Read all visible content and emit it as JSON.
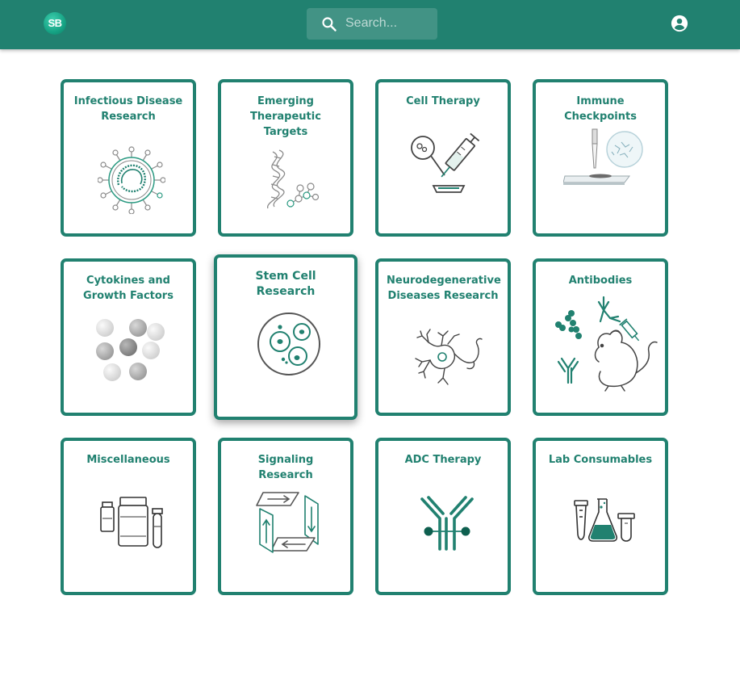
{
  "header": {
    "logo_text": "SB",
    "search_placeholder": "Search...",
    "brand_color": "#218170"
  },
  "icons": {
    "logo": "sb-logo-icon",
    "search": "search-icon",
    "account": "account-circle-icon"
  },
  "categories": [
    {
      "title": "Infectious Disease Research",
      "icon": "virus-icon"
    },
    {
      "title": "Emerging Therapeutic Targets",
      "icon": "dna-molecule-icon"
    },
    {
      "title": "Cell Therapy",
      "icon": "cell-syringe-icon"
    },
    {
      "title": "Immune Checkpoints",
      "icon": "pipette-slide-icon"
    },
    {
      "title": "Cytokines and Growth Factors",
      "icon": "spheres-icon"
    },
    {
      "title": "Stem Cell Research",
      "icon": "petri-cells-icon"
    },
    {
      "title": "Neurodegenerative Diseases Research",
      "icon": "neuron-icon"
    },
    {
      "title": "Antibodies",
      "icon": "antibody-mouse-icon"
    },
    {
      "title": "Miscellaneous",
      "icon": "vials-icon"
    },
    {
      "title": "Signaling Research",
      "icon": "signaling-arrows-icon"
    },
    {
      "title": "ADC Therapy",
      "icon": "adc-antibody-icon"
    },
    {
      "title": "Lab Consumables",
      "icon": "labware-icon"
    }
  ]
}
